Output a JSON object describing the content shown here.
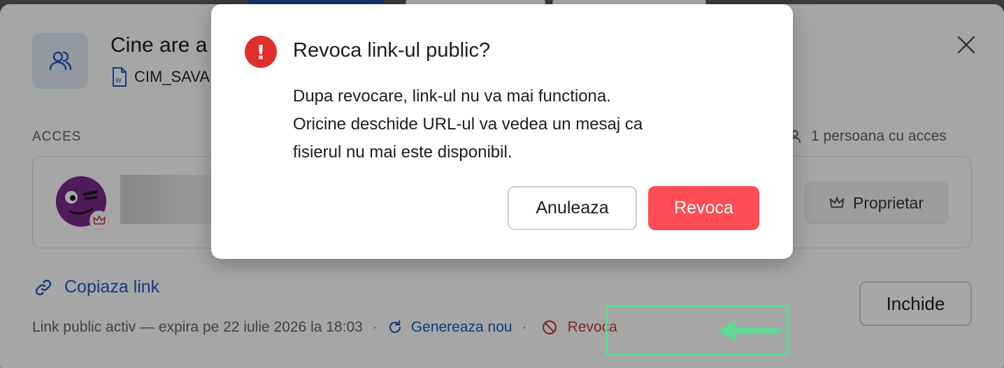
{
  "share_dialog": {
    "title": "Cine are a",
    "file_name": "CIM_SAVA",
    "acces_label": "ACCES",
    "persons_count": "1 persoana cu acces",
    "owner_label": "Proprietar",
    "copy_link_label": "Copiaza link",
    "close_button_label": "Inchide",
    "link_status": "Link public activ — expira pe 22 iulie 2026 la 18:03",
    "separator": "·",
    "regenerate_label": "Genereaza nou",
    "revoke_label": "Revoca"
  },
  "modal": {
    "title": "Revoca link-ul public?",
    "alert_glyph": "!",
    "body_line1": "Dupa revocare, link-ul nu va mai functiona.",
    "body_line2": "Oricine deschide URL-ul va vedea un mesaj ca",
    "body_line3": "fisierul nu mai este disponibil.",
    "cancel_label": "Anuleaza",
    "confirm_label": "Revoca"
  },
  "colors": {
    "accent_blue": "#1f5bbf",
    "danger_red": "#ff4c55",
    "revoke_text": "#c93d3d",
    "highlight_green": "#5fd896"
  }
}
